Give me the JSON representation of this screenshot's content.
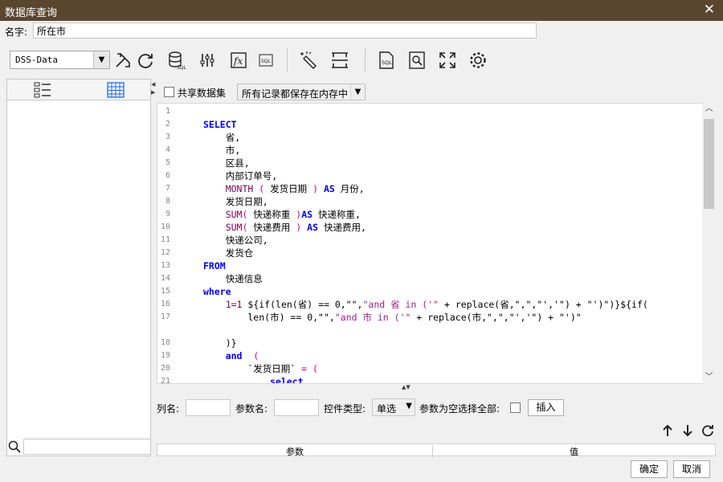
{
  "window": {
    "title": "数据库查询",
    "close_label": "✕"
  },
  "name_field": {
    "label": "名字:",
    "value": "所在市"
  },
  "datasource": {
    "selected": "DSS-Data"
  },
  "toolbar": {
    "icons": [
      "tools-icon",
      "refresh-icon",
      "database-sql-icon",
      "sliders-icon",
      "formula-icon",
      "sql-small-icon",
      "magic-wand-icon",
      "pagination-icon",
      "sql-file-icon",
      "preview-icon",
      "fullscreen-icon",
      "settings-icon"
    ]
  },
  "share": {
    "label": "共享数据集",
    "checked": false
  },
  "cache_mode": {
    "selected": "所有记录都保存在内存中"
  },
  "editor": {
    "lines": [
      {
        "n": "1",
        "html": ""
      },
      {
        "n": "2",
        "html": "<span class=\"kw\">SELECT</span>"
      },
      {
        "n": "3",
        "html": "    省,"
      },
      {
        "n": "4",
        "html": "    市,"
      },
      {
        "n": "5",
        "html": "    区县,"
      },
      {
        "n": "6",
        "html": "    内部订单号,"
      },
      {
        "n": "7",
        "html": "    <span class=\"fn\">MONTH</span> <span class=\"paren\">(</span> 发货日期 <span class=\"paren\">)</span> <span class=\"kw\">AS</span> 月份,"
      },
      {
        "n": "8",
        "html": "    发货日期,"
      },
      {
        "n": "9",
        "html": "    <span class=\"fn\">SUM</span><span class=\"paren\">(</span> 快递称重 <span class=\"paren\">)</span><span class=\"kw\">AS</span> 快递称重,"
      },
      {
        "n": "10",
        "html": "    <span class=\"fn\">SUM</span><span class=\"paren\">(</span> 快递费用 <span class=\"paren\">)</span> <span class=\"kw\">AS</span> 快递费用,"
      },
      {
        "n": "11",
        "html": "    快递公司,"
      },
      {
        "n": "12",
        "html": "    发货仓"
      },
      {
        "n": "13",
        "html": "<span class=\"kw\">FROM</span>"
      },
      {
        "n": "14",
        "html": "    快递信息"
      },
      {
        "n": "15",
        "html": "<span class=\"kw\">where</span>"
      },
      {
        "n": "16",
        "html": "    <span class=\"fn\">1=1</span> ${if(len(省) == 0,\"\",<span class=\"str\">\"and 省 in ('\"</span> + replace(省,\",\",\"','\") + \"')\")}${if("
      },
      {
        "n": "17",
        "html": "        len(市) == 0,\"\",<span class=\"str\">\"and 市 in ('\"</span> + replace(市,\",\",\"','\") + \"')\""
      },
      {
        "n": "",
        "html": ""
      },
      {
        "n": "18",
        "html": "    )}"
      },
      {
        "n": "19",
        "html": "    <span class=\"kw\">and</span>  <span class=\"paren\">(</span>"
      },
      {
        "n": "20",
        "html": "        `发货日期` <span class=\"paren\">= (</span>"
      },
      {
        "n": "21",
        "html": "            <span class=\"kw\">select</span>"
      }
    ]
  },
  "params_row": {
    "column_label": "列名:",
    "param_name_label": "参数名:",
    "control_type_label": "控件类型:",
    "control_type_value": "单选",
    "select_all_label": "参数为空选择全部:",
    "insert_button": "插入"
  },
  "param_table": {
    "col_param": "参数",
    "col_value": "值"
  },
  "footer": {
    "ok": "确定",
    "cancel": "取消"
  }
}
